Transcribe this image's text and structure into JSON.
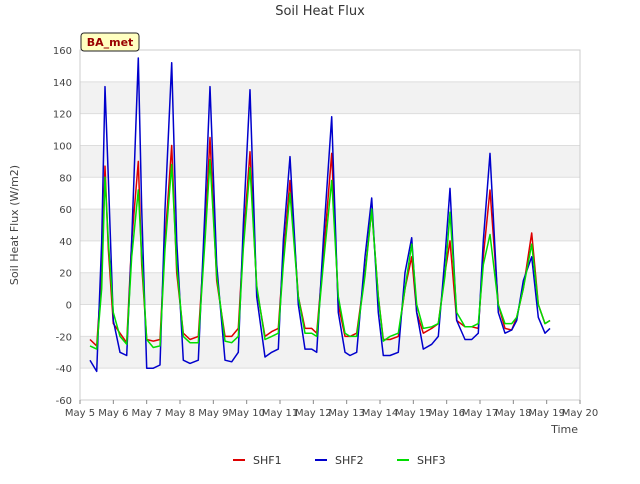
{
  "chart_data": {
    "type": "line",
    "title": "Soil Heat Flux",
    "xlabel": "Time",
    "ylabel": "Soil Heat Flux (W/m2)",
    "site_badge": "BA_met",
    "xlim": [
      5,
      20
    ],
    "ylim": [
      -60,
      160
    ],
    "yticks": [
      -60,
      -40,
      -20,
      0,
      20,
      40,
      60,
      80,
      100,
      120,
      140,
      160
    ],
    "xticks": [
      {
        "v": 5,
        "label": "May 5"
      },
      {
        "v": 6,
        "label": "May 6"
      },
      {
        "v": 7,
        "label": "May 7"
      },
      {
        "v": 8,
        "label": "May 8"
      },
      {
        "v": 9,
        "label": "May 9"
      },
      {
        "v": 10,
        "label": "May 10"
      },
      {
        "v": 11,
        "label": "May 11"
      },
      {
        "v": 12,
        "label": "May 12"
      },
      {
        "v": 13,
        "label": "May 13"
      },
      {
        "v": 14,
        "label": "May 14"
      },
      {
        "v": 15,
        "label": "May 15"
      },
      {
        "v": 16,
        "label": "May 16"
      },
      {
        "v": 17,
        "label": "May 17"
      },
      {
        "v": 18,
        "label": "May 18"
      },
      {
        "v": 19,
        "label": "May 19"
      },
      {
        "v": 20,
        "label": "May 20"
      }
    ],
    "grid": true,
    "legend_position": "bottom",
    "series": [
      {
        "name": "SHF1",
        "color": "#dd0000",
        "x": [
          5.3,
          5.5,
          5.65,
          5.75,
          5.85,
          6.0,
          6.2,
          6.4,
          6.55,
          6.75,
          6.85,
          7.0,
          7.2,
          7.4,
          7.55,
          7.75,
          7.9,
          8.1,
          8.3,
          8.55,
          8.75,
          8.9,
          9.1,
          9.35,
          9.55,
          9.75,
          9.9,
          10.1,
          10.3,
          10.55,
          10.75,
          10.95,
          11.1,
          11.3,
          11.55,
          11.75,
          11.95,
          12.1,
          12.3,
          12.55,
          12.75,
          12.95,
          13.1,
          13.3,
          13.55,
          13.75,
          13.95,
          14.1,
          14.3,
          14.55,
          14.75,
          14.95,
          15.1,
          15.3,
          15.55,
          15.75,
          15.95,
          16.1,
          16.3,
          16.55,
          16.75,
          16.95,
          17.1,
          17.3,
          17.55,
          17.75,
          17.95,
          18.1,
          18.3,
          18.55,
          18.75,
          18.95,
          19.1
        ],
        "y": [
          -22,
          -26,
          20,
          87,
          35,
          -12,
          -18,
          -24,
          40,
          90,
          25,
          -22,
          -23,
          -22,
          40,
          100,
          20,
          -18,
          -22,
          -20,
          45,
          105,
          15,
          -20,
          -20,
          -15,
          40,
          96,
          10,
          -20,
          -17,
          -15,
          30,
          78,
          5,
          -15,
          -15,
          -18,
          30,
          95,
          0,
          -20,
          -20,
          -18,
          20,
          60,
          5,
          -22,
          -22,
          -20,
          10,
          30,
          -5,
          -18,
          -15,
          -12,
          20,
          40,
          -10,
          -14,
          -14,
          -15,
          30,
          72,
          0,
          -15,
          -16,
          -8,
          10,
          45,
          0,
          -12,
          -10
        ]
      },
      {
        "name": "SHF2",
        "color": "#0000cc",
        "x": [
          5.3,
          5.5,
          5.65,
          5.75,
          5.85,
          6.0,
          6.2,
          6.4,
          6.55,
          6.75,
          6.85,
          7.0,
          7.2,
          7.4,
          7.55,
          7.75,
          7.9,
          8.1,
          8.3,
          8.55,
          8.75,
          8.9,
          9.1,
          9.35,
          9.55,
          9.75,
          9.9,
          10.1,
          10.3,
          10.55,
          10.75,
          10.95,
          11.1,
          11.3,
          11.55,
          11.75,
          11.95,
          12.1,
          12.3,
          12.55,
          12.75,
          12.95,
          13.1,
          13.3,
          13.55,
          13.75,
          13.95,
          14.1,
          14.3,
          14.55,
          14.75,
          14.95,
          15.1,
          15.3,
          15.55,
          15.75,
          15.95,
          16.1,
          16.3,
          16.55,
          16.75,
          16.95,
          17.1,
          17.3,
          17.55,
          17.75,
          17.95,
          18.1,
          18.3,
          18.55,
          18.75,
          18.95,
          19.1
        ],
        "y": [
          -35,
          -42,
          40,
          137,
          80,
          -10,
          -30,
          -32,
          40,
          155,
          60,
          -40,
          -40,
          -38,
          60,
          152,
          40,
          -35,
          -37,
          -35,
          60,
          137,
          25,
          -35,
          -36,
          -30,
          50,
          135,
          5,
          -33,
          -30,
          -28,
          40,
          93,
          0,
          -28,
          -28,
          -30,
          40,
          118,
          -5,
          -30,
          -32,
          -30,
          30,
          67,
          -5,
          -32,
          -32,
          -30,
          20,
          42,
          -5,
          -28,
          -25,
          -20,
          30,
          73,
          -10,
          -22,
          -22,
          -18,
          40,
          95,
          -5,
          -18,
          -16,
          -10,
          15,
          30,
          -8,
          -18,
          -15
        ]
      },
      {
        "name": "SHF3",
        "color": "#00dd00",
        "x": [
          5.3,
          5.5,
          5.65,
          5.75,
          5.85,
          6.0,
          6.2,
          6.4,
          6.55,
          6.75,
          6.85,
          7.0,
          7.2,
          7.4,
          7.55,
          7.75,
          7.9,
          8.1,
          8.3,
          8.55,
          8.75,
          8.9,
          9.1,
          9.35,
          9.55,
          9.75,
          9.9,
          10.1,
          10.3,
          10.55,
          10.75,
          10.95,
          11.1,
          11.3,
          11.55,
          11.75,
          11.95,
          12.1,
          12.3,
          12.55,
          12.75,
          12.95,
          13.1,
          13.3,
          13.55,
          13.75,
          13.95,
          14.1,
          14.3,
          14.55,
          14.75,
          14.95,
          15.1,
          15.3,
          15.55,
          15.75,
          15.95,
          16.1,
          16.3,
          16.55,
          16.75,
          16.95,
          17.1,
          17.3,
          17.55,
          17.75,
          17.95,
          18.1,
          18.3,
          18.55,
          18.75,
          18.95,
          19.1
        ],
        "y": [
          -26,
          -28,
          10,
          80,
          40,
          -5,
          -20,
          -25,
          30,
          72,
          30,
          -22,
          -27,
          -26,
          35,
          88,
          25,
          -20,
          -24,
          -24,
          40,
          91,
          18,
          -23,
          -24,
          -20,
          35,
          86,
          12,
          -22,
          -20,
          -18,
          25,
          70,
          5,
          -18,
          -18,
          -20,
          25,
          78,
          5,
          -18,
          -20,
          -20,
          18,
          60,
          5,
          -23,
          -20,
          -18,
          10,
          38,
          0,
          -15,
          -14,
          -12,
          18,
          58,
          -5,
          -14,
          -14,
          -12,
          25,
          44,
          0,
          -12,
          -12,
          -8,
          10,
          38,
          0,
          -12,
          -10
        ]
      }
    ]
  }
}
